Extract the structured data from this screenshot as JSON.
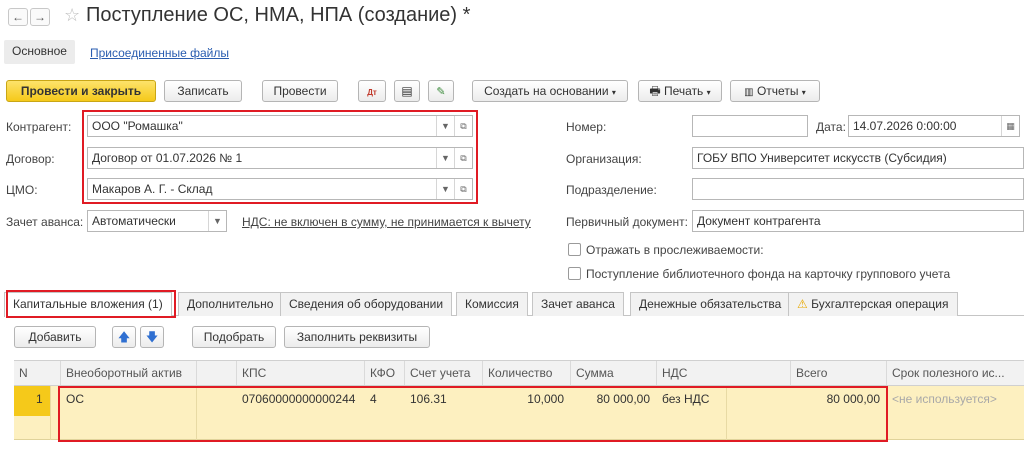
{
  "header": {
    "title": "Поступление ОС, НМА, НПА (создание) *",
    "back_icon": "arrow-left",
    "forward_icon": "arrow-right"
  },
  "nav_tabs": {
    "main": "Основное",
    "attached": "Присоединенные файлы"
  },
  "toolbar": {
    "post_close": "Провести и закрыть",
    "save": "Записать",
    "post": "Провести",
    "create_based": "Создать на основании",
    "print": "Печать",
    "reports": "Отчеты"
  },
  "form": {
    "counterparty_label": "Контрагент:",
    "counterparty_value": "ООО \"Ромашка\"",
    "contract_label": "Договор:",
    "contract_value": "Договор от 01.07.2026 № 1",
    "cmo_label": "ЦМО:",
    "cmo_value": "Макаров А. Г. - Склад",
    "advance_label": "Зачет аванса:",
    "advance_value": "Автоматически",
    "vat_link": "НДС: не включен в сумму, не принимается к вычету",
    "number_label": "Номер:",
    "number_value": "",
    "date_label": "Дата:",
    "date_value": "14.07.2026  0:00:00",
    "org_label": "Организация:",
    "org_value": "ГОБУ ВПО Университет искусств (Субсидия)",
    "dept_label": "Подразделение:",
    "dept_value": "",
    "primary_doc_label": "Первичный документ:",
    "primary_doc_value": "Документ контрагента",
    "check_traceability": "Отражать в прослеживаемости:",
    "check_library": "Поступление библиотечного фонда на карточку группового учета"
  },
  "tabs": [
    "Капитальные вложения (1)",
    "Дополнительно",
    "Сведения об оборудовании",
    "Комиссия",
    "Зачет аванса",
    "Денежные обязательства",
    "Бухгалтерская операция"
  ],
  "table_toolbar": {
    "add": "Добавить",
    "pick": "Подобрать",
    "fill": "Заполнить реквизиты"
  },
  "table": {
    "columns": [
      "N",
      "Внеоборотный актив",
      "КПС",
      "КФО",
      "Счет учета",
      "Количество",
      "Сумма",
      "НДС",
      "Всего",
      "Срок полезного ис..."
    ],
    "rows": [
      {
        "n": "1",
        "asset": "ОС",
        "kps": "07060000000000244",
        "kfo": "4",
        "account": "106.31",
        "qty": "10,000",
        "sum": "80 000,00",
        "vat": "без НДС",
        "total": "80 000,00",
        "life": "<не используется>"
      }
    ]
  },
  "colors": {
    "accent_yellow": "#f5c91a",
    "highlight_red": "#e01b24",
    "row_bg": "#fdf0c0",
    "link": "#2a5db0"
  }
}
